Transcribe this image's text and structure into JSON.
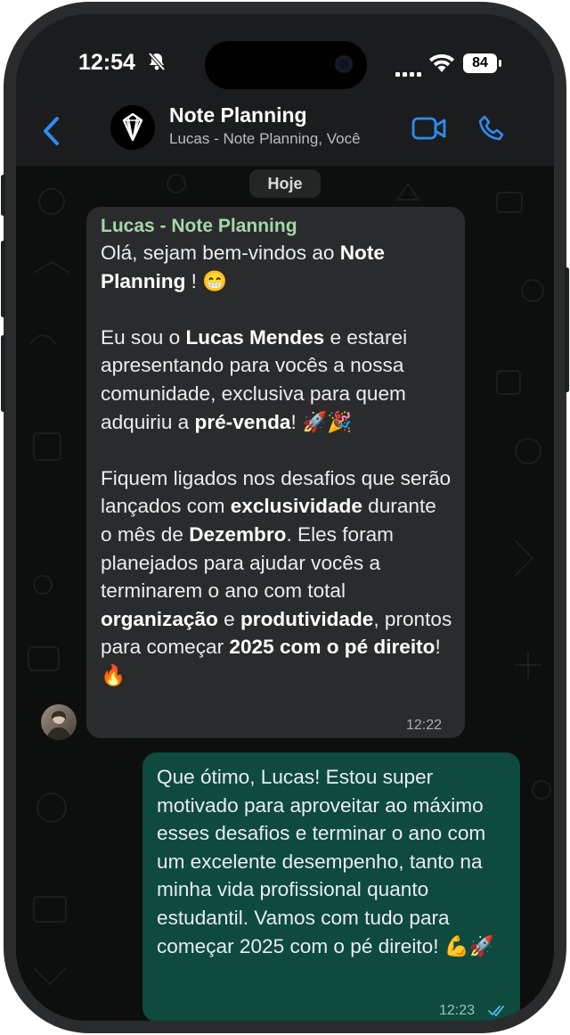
{
  "status_bar": {
    "time": "12:54",
    "battery": "84"
  },
  "header": {
    "title": "Note Planning",
    "subtitle": "Lucas - Note Planning, Você"
  },
  "chat": {
    "date_separator": "Hoje",
    "messages": [
      {
        "direction": "incoming",
        "sender": "Lucas - Note Planning",
        "text": "Olá, sejam bem-vindos ao Note Planning ! 😁\n\nEu sou o Lucas Mendes e estarei apresentando para vocês a nossa comunidade, exclusiva para quem adquiriu a pré-venda! 🚀🎉\n\nFiquem ligados nos desafios que serão lançados com exclusividade durante o mês de Dezembro. Eles foram planejados para ajudar vocês a terminarem o ano com total organização e produtividade, prontos para começar 2025 com o pé direito! 🔥",
        "time": "12:22"
      },
      {
        "direction": "outgoing",
        "text": "Que ótimo, Lucas! Estou super motivado para aproveitar ao máximo esses desafios e terminar o ano com um excelente desempenho, tanto na minha vida profissional quanto estudantil. Vamos com tudo para começar 2025 com o pé direito! 💪🚀",
        "time": "12:23",
        "status": "read"
      }
    ]
  },
  "colors": {
    "accent_blue": "#2d8cf0",
    "incoming_bubble": "#2a2b2c",
    "outgoing_bubble": "#0e4a3e",
    "sender_name": "#a4d7a8"
  },
  "icons": [
    "bell-slash-icon",
    "signal-icon",
    "wifi-icon",
    "battery-icon",
    "back-chevron-icon",
    "group-logo-icon",
    "video-call-icon",
    "phone-call-icon",
    "read-ticks-icon"
  ]
}
